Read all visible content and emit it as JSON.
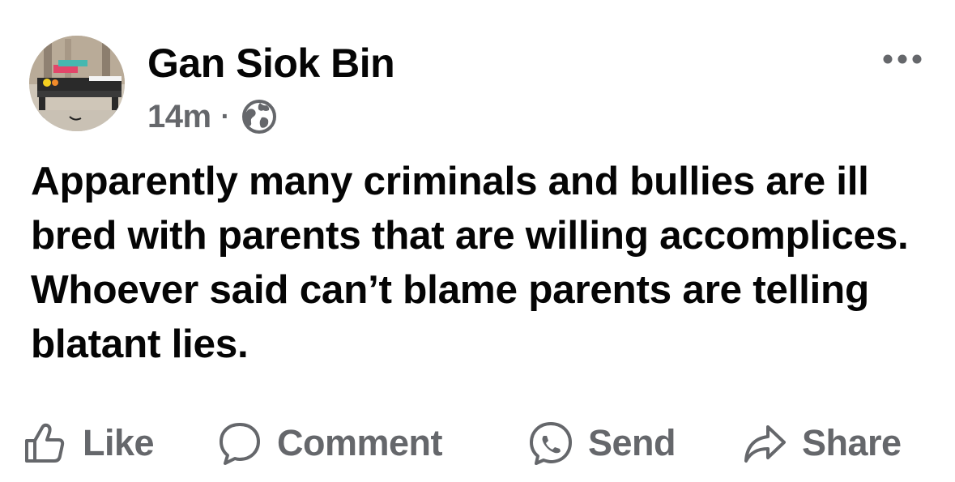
{
  "post": {
    "author": "Gan Siok Bin",
    "timestamp": "14m",
    "separator": "·",
    "audience_icon": "globe-icon",
    "text": "Apparently many criminals and bullies are ill bred with parents that are willing accomplices. Whoever said can’t blame parents are telling blatant lies.",
    "more_icon": "more-options-icon"
  },
  "actions": {
    "like": {
      "label": "Like",
      "icon": "thumbs-up-icon"
    },
    "comment": {
      "label": "Comment",
      "icon": "comment-bubble-icon"
    },
    "send": {
      "label": "Send",
      "icon": "messenger-icon"
    },
    "share": {
      "label": "Share",
      "icon": "share-arrow-icon"
    }
  },
  "colors": {
    "text_primary": "#050505",
    "text_secondary": "#65676b",
    "background": "#ffffff"
  }
}
